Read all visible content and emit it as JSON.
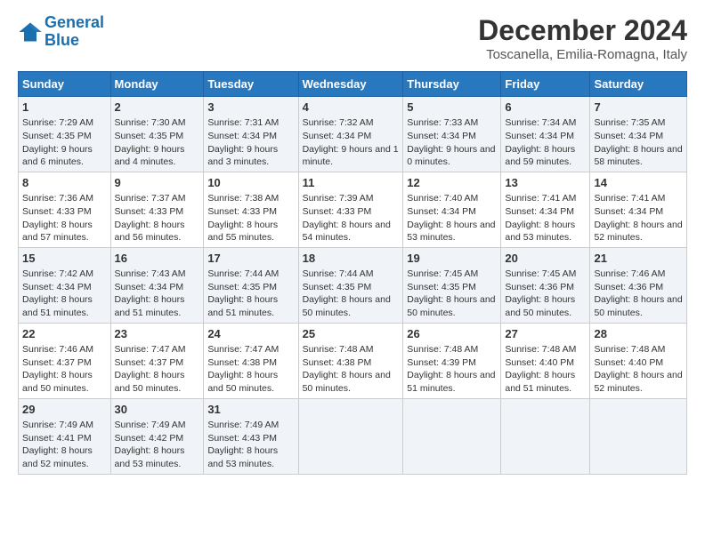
{
  "header": {
    "logo_line1": "General",
    "logo_line2": "Blue",
    "main_title": "December 2024",
    "subtitle": "Toscanella, Emilia-Romagna, Italy"
  },
  "columns": [
    "Sunday",
    "Monday",
    "Tuesday",
    "Wednesday",
    "Thursday",
    "Friday",
    "Saturday"
  ],
  "weeks": [
    [
      {
        "day": "1",
        "sunrise": "Sunrise: 7:29 AM",
        "sunset": "Sunset: 4:35 PM",
        "daylight": "Daylight: 9 hours and 6 minutes."
      },
      {
        "day": "2",
        "sunrise": "Sunrise: 7:30 AM",
        "sunset": "Sunset: 4:35 PM",
        "daylight": "Daylight: 9 hours and 4 minutes."
      },
      {
        "day": "3",
        "sunrise": "Sunrise: 7:31 AM",
        "sunset": "Sunset: 4:34 PM",
        "daylight": "Daylight: 9 hours and 3 minutes."
      },
      {
        "day": "4",
        "sunrise": "Sunrise: 7:32 AM",
        "sunset": "Sunset: 4:34 PM",
        "daylight": "Daylight: 9 hours and 1 minute."
      },
      {
        "day": "5",
        "sunrise": "Sunrise: 7:33 AM",
        "sunset": "Sunset: 4:34 PM",
        "daylight": "Daylight: 9 hours and 0 minutes."
      },
      {
        "day": "6",
        "sunrise": "Sunrise: 7:34 AM",
        "sunset": "Sunset: 4:34 PM",
        "daylight": "Daylight: 8 hours and 59 minutes."
      },
      {
        "day": "7",
        "sunrise": "Sunrise: 7:35 AM",
        "sunset": "Sunset: 4:34 PM",
        "daylight": "Daylight: 8 hours and 58 minutes."
      }
    ],
    [
      {
        "day": "8",
        "sunrise": "Sunrise: 7:36 AM",
        "sunset": "Sunset: 4:33 PM",
        "daylight": "Daylight: 8 hours and 57 minutes."
      },
      {
        "day": "9",
        "sunrise": "Sunrise: 7:37 AM",
        "sunset": "Sunset: 4:33 PM",
        "daylight": "Daylight: 8 hours and 56 minutes."
      },
      {
        "day": "10",
        "sunrise": "Sunrise: 7:38 AM",
        "sunset": "Sunset: 4:33 PM",
        "daylight": "Daylight: 8 hours and 55 minutes."
      },
      {
        "day": "11",
        "sunrise": "Sunrise: 7:39 AM",
        "sunset": "Sunset: 4:33 PM",
        "daylight": "Daylight: 8 hours and 54 minutes."
      },
      {
        "day": "12",
        "sunrise": "Sunrise: 7:40 AM",
        "sunset": "Sunset: 4:34 PM",
        "daylight": "Daylight: 8 hours and 53 minutes."
      },
      {
        "day": "13",
        "sunrise": "Sunrise: 7:41 AM",
        "sunset": "Sunset: 4:34 PM",
        "daylight": "Daylight: 8 hours and 53 minutes."
      },
      {
        "day": "14",
        "sunrise": "Sunrise: 7:41 AM",
        "sunset": "Sunset: 4:34 PM",
        "daylight": "Daylight: 8 hours and 52 minutes."
      }
    ],
    [
      {
        "day": "15",
        "sunrise": "Sunrise: 7:42 AM",
        "sunset": "Sunset: 4:34 PM",
        "daylight": "Daylight: 8 hours and 51 minutes."
      },
      {
        "day": "16",
        "sunrise": "Sunrise: 7:43 AM",
        "sunset": "Sunset: 4:34 PM",
        "daylight": "Daylight: 8 hours and 51 minutes."
      },
      {
        "day": "17",
        "sunrise": "Sunrise: 7:44 AM",
        "sunset": "Sunset: 4:35 PM",
        "daylight": "Daylight: 8 hours and 51 minutes."
      },
      {
        "day": "18",
        "sunrise": "Sunrise: 7:44 AM",
        "sunset": "Sunset: 4:35 PM",
        "daylight": "Daylight: 8 hours and 50 minutes."
      },
      {
        "day": "19",
        "sunrise": "Sunrise: 7:45 AM",
        "sunset": "Sunset: 4:35 PM",
        "daylight": "Daylight: 8 hours and 50 minutes."
      },
      {
        "day": "20",
        "sunrise": "Sunrise: 7:45 AM",
        "sunset": "Sunset: 4:36 PM",
        "daylight": "Daylight: 8 hours and 50 minutes."
      },
      {
        "day": "21",
        "sunrise": "Sunrise: 7:46 AM",
        "sunset": "Sunset: 4:36 PM",
        "daylight": "Daylight: 8 hours and 50 minutes."
      }
    ],
    [
      {
        "day": "22",
        "sunrise": "Sunrise: 7:46 AM",
        "sunset": "Sunset: 4:37 PM",
        "daylight": "Daylight: 8 hours and 50 minutes."
      },
      {
        "day": "23",
        "sunrise": "Sunrise: 7:47 AM",
        "sunset": "Sunset: 4:37 PM",
        "daylight": "Daylight: 8 hours and 50 minutes."
      },
      {
        "day": "24",
        "sunrise": "Sunrise: 7:47 AM",
        "sunset": "Sunset: 4:38 PM",
        "daylight": "Daylight: 8 hours and 50 minutes."
      },
      {
        "day": "25",
        "sunrise": "Sunrise: 7:48 AM",
        "sunset": "Sunset: 4:38 PM",
        "daylight": "Daylight: 8 hours and 50 minutes."
      },
      {
        "day": "26",
        "sunrise": "Sunrise: 7:48 AM",
        "sunset": "Sunset: 4:39 PM",
        "daylight": "Daylight: 8 hours and 51 minutes."
      },
      {
        "day": "27",
        "sunrise": "Sunrise: 7:48 AM",
        "sunset": "Sunset: 4:40 PM",
        "daylight": "Daylight: 8 hours and 51 minutes."
      },
      {
        "day": "28",
        "sunrise": "Sunrise: 7:48 AM",
        "sunset": "Sunset: 4:40 PM",
        "daylight": "Daylight: 8 hours and 52 minutes."
      }
    ],
    [
      {
        "day": "29",
        "sunrise": "Sunrise: 7:49 AM",
        "sunset": "Sunset: 4:41 PM",
        "daylight": "Daylight: 8 hours and 52 minutes."
      },
      {
        "day": "30",
        "sunrise": "Sunrise: 7:49 AM",
        "sunset": "Sunset: 4:42 PM",
        "daylight": "Daylight: 8 hours and 53 minutes."
      },
      {
        "day": "31",
        "sunrise": "Sunrise: 7:49 AM",
        "sunset": "Sunset: 4:43 PM",
        "daylight": "Daylight: 8 hours and 53 minutes."
      },
      null,
      null,
      null,
      null
    ]
  ]
}
